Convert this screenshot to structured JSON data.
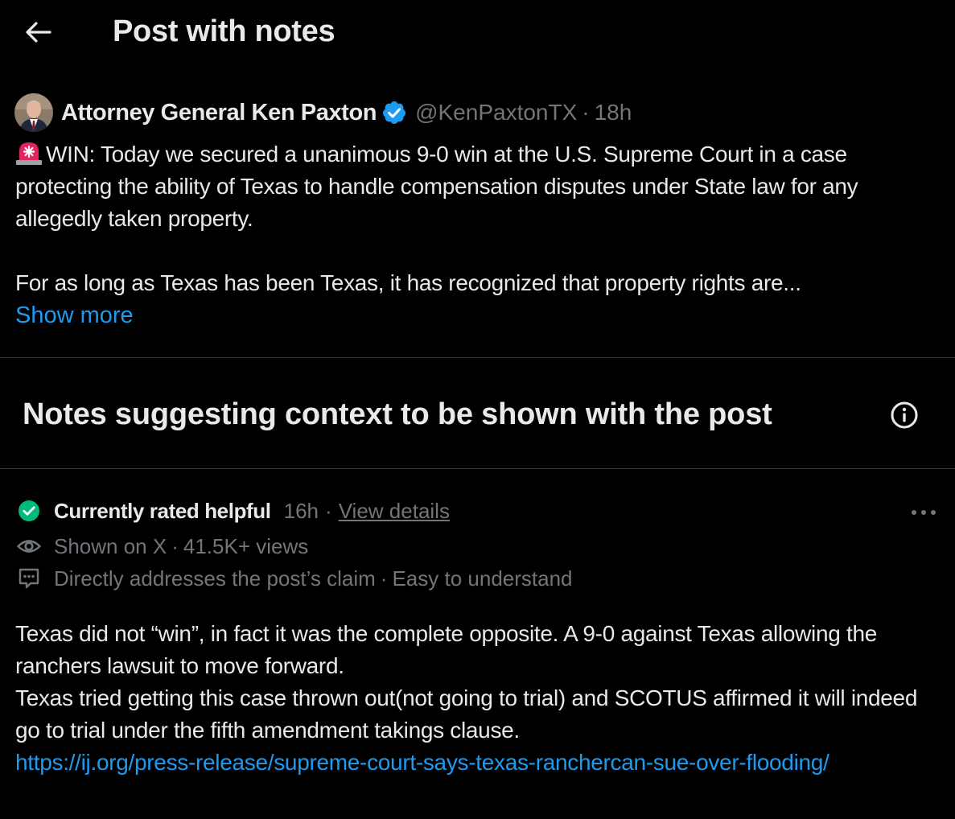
{
  "header": {
    "title": "Post with notes",
    "back_icon": "back-arrow-icon"
  },
  "post": {
    "author_name": "Attorney General Ken Paxton",
    "verified_icon": "verified-badge-icon",
    "handle": "@KenPaxtonTX",
    "separator": "·",
    "time": "18h",
    "siren_icon": "siren-emoji-icon",
    "text_line1": "WIN: Today we secured a unanimous 9-0 win at the U.S. Supreme Court in a case protecting the ability of Texas to handle compensation disputes under State law for any allegedly taken property.",
    "text_line2": "For as long as Texas has been Texas, it has recognized that property rights are...",
    "show_more": "Show more"
  },
  "notes_section": {
    "title": "Notes suggesting context to be shown with the post",
    "info_icon": "info-circle-icon"
  },
  "note": {
    "status_icon": "check-circle-icon",
    "status_label": "Currently rated helpful",
    "time": "16h",
    "separator": "·",
    "view_details": "View details",
    "more_icon": "more-horizontal-icon",
    "views_icon": "eye-icon",
    "shown_on": "Shown on X",
    "views": "41.5K+ views",
    "reasons_icon": "note-speech-icon",
    "reason_1": "Directly addresses the post’s claim",
    "reason_2": "Easy to understand",
    "body_line1": "Texas did not “win”, in fact it was the complete opposite. A 9-0 against Texas allowing the ranchers lawsuit to move forward.",
    "body_line2": "Texas tried getting this case thrown out(not going to trial) and SCOTUS affirmed it will indeed go to trial under the fifth amendment takings clause.",
    "link": "https://ij.org/press-release/supreme-court-says-texas-ranchercan-sue-over-flooding/"
  },
  "colors": {
    "background": "#000000",
    "text": "#e7e9ea",
    "muted": "#71767b",
    "link": "#1d9bf0",
    "divider": "#2f3336",
    "verified": "#1d9bf0",
    "helpful_green": "#00ba7c"
  }
}
